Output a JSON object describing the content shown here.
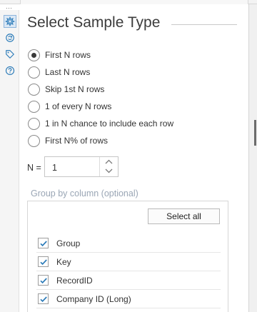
{
  "panel": {
    "title": "Select Sample Type"
  },
  "rail": {
    "icons": [
      "gear-icon",
      "refresh-circle-icon",
      "tag-icon",
      "help-icon"
    ]
  },
  "sample_options": [
    {
      "label": "First N rows",
      "selected": true
    },
    {
      "label": "Last N rows",
      "selected": false
    },
    {
      "label": "Skip 1st N rows",
      "selected": false
    },
    {
      "label": "1 of every N rows",
      "selected": false
    },
    {
      "label": "1 in N chance to include each row",
      "selected": false
    },
    {
      "label": "First N% of rows",
      "selected": false
    }
  ],
  "n_field": {
    "label": "N =",
    "value": "1"
  },
  "group_by": {
    "label": "Group by column (optional)",
    "select_all_label": "Select all",
    "columns": [
      {
        "label": "Group",
        "checked": true
      },
      {
        "label": "Key",
        "checked": true
      },
      {
        "label": "RecordID",
        "checked": true
      },
      {
        "label": "Company ID (Long)",
        "checked": true
      }
    ]
  },
  "colors": {
    "accent": "#2a7ab8",
    "group_label": "#9aa6b5",
    "active_rail_bg": "#dbe8f5"
  }
}
